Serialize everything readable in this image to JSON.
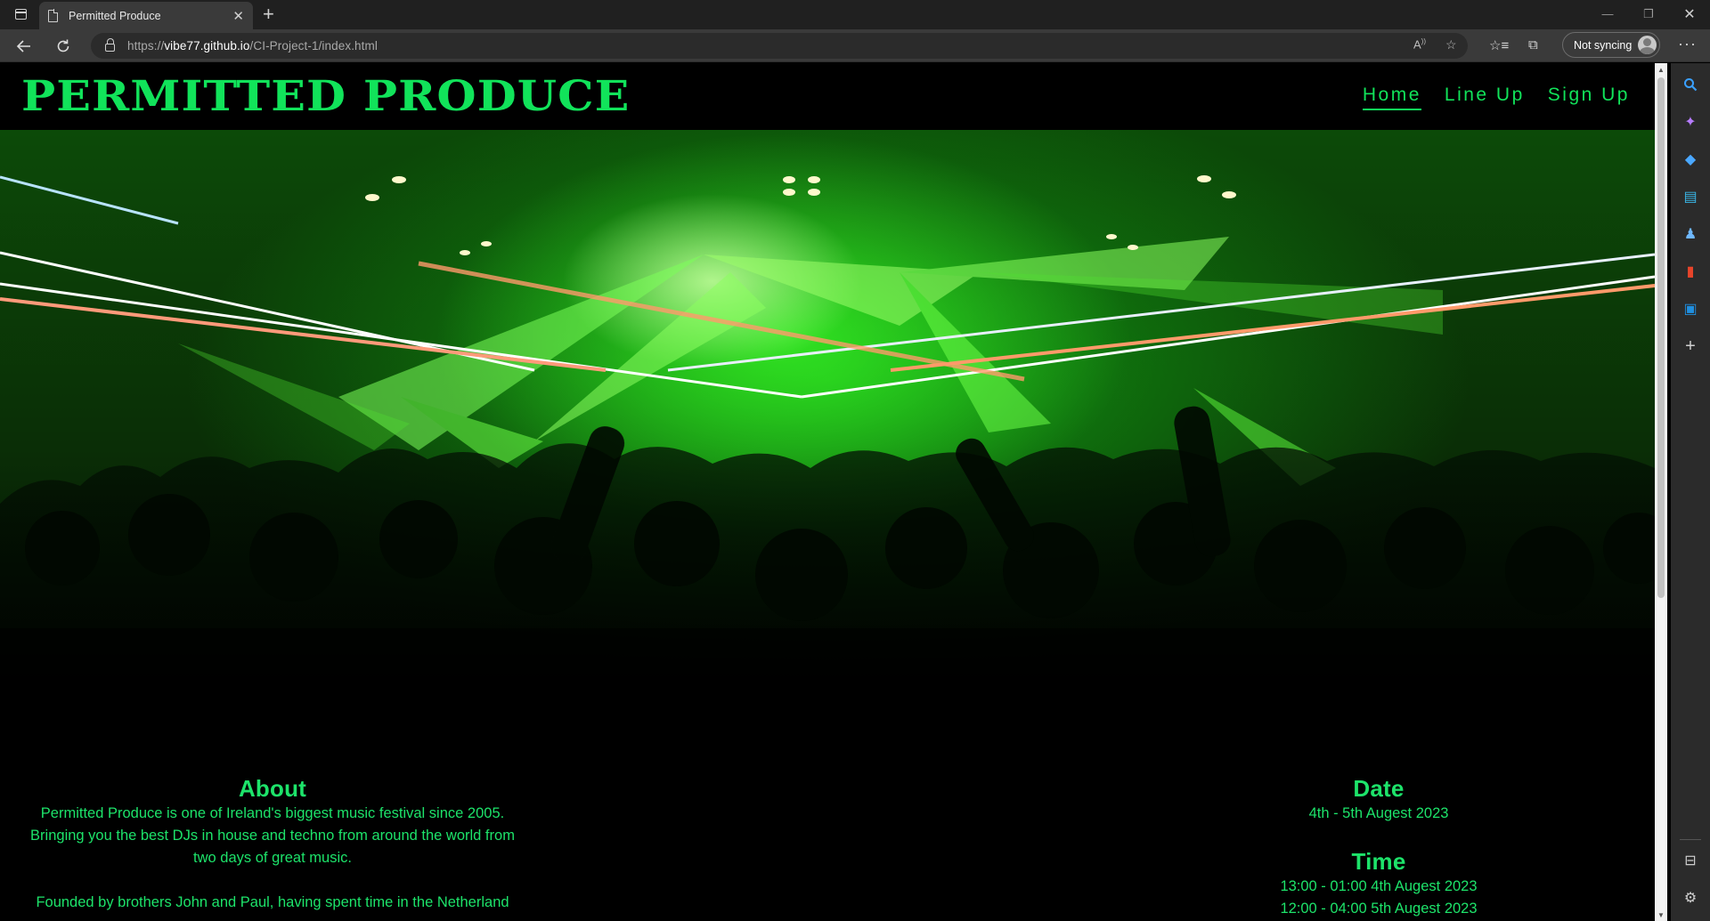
{
  "browser": {
    "tab_title": "Permitted Produce",
    "tab_close": "✕",
    "new_tab": "+",
    "url_scheme": "https://",
    "url_host": "vibe77.github.io",
    "url_path": "/CI-Project-1/index.html",
    "sync_label": "Not syncing",
    "window_min": "—",
    "window_max": "❐",
    "window_close": "✕"
  },
  "site": {
    "title": "PERMITTED PRODUCE",
    "nav": [
      {
        "label": "Home",
        "active": true
      },
      {
        "label": "Line Up",
        "active": false
      },
      {
        "label": "Sign Up",
        "active": false
      }
    ],
    "about": {
      "heading": "About",
      "para1_line1": "Permitted Produce is one of Ireland's biggest music festival since 2005.",
      "para1_line2": "Bringing you the best DJs in house and techno from around the world from",
      "para1_line3": "two days of great music.",
      "para2_line1": "Founded by brothers John and Paul, having spent time in the Netherland"
    },
    "date": {
      "heading": "Date",
      "value": "4th - 5th Augest 2023"
    },
    "time": {
      "heading": "Time",
      "line1": "13:00 - 01:00 4th Augest 2023",
      "line2": "12:00 - 04:00 5th Augest 2023"
    }
  },
  "colors": {
    "accent": "#11e35a",
    "page_bg": "#000000",
    "chrome_bg": "#3a3a3a"
  },
  "icons": {
    "sidebar": [
      "search-icon",
      "copilot-icon",
      "shopping-tag-icon",
      "tools-briefcase-icon",
      "games-icon",
      "office-icon",
      "outlook-icon",
      "add-icon",
      "sidebar-toggle-icon",
      "settings-icon"
    ]
  }
}
